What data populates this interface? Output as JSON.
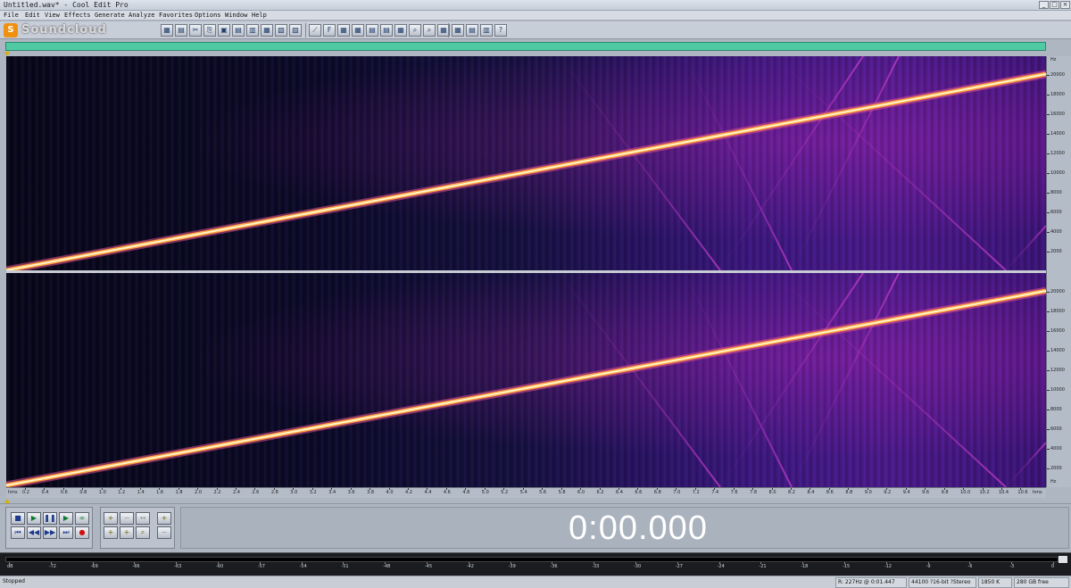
{
  "window": {
    "title": "Untitled.wav* - Cool Edit Pro",
    "minimize": "_",
    "maximize": "□",
    "close": "×"
  },
  "menu": [
    "File",
    "Edit",
    "View",
    "Effects",
    "Generate",
    "Analyze",
    "Favorites",
    "Options",
    "Window",
    "Help"
  ],
  "watermark": {
    "logo": "S",
    "text": "Soundcloud"
  },
  "spectrogram": {
    "channels": 2,
    "colors": {
      "background": "#0a0820",
      "noise": "#4c1a8c",
      "sweep_core": "#fff7c8",
      "sweep_glow": "#e0508c",
      "alias": "#c83cc8"
    }
  },
  "freq_ruler": {
    "unit": "Hz",
    "channel_left": [
      "20000",
      "18000",
      "16000",
      "14000",
      "12000",
      "10000",
      "8000",
      "6000",
      "4000",
      "2000"
    ],
    "channel_right": [
      "20000",
      "18000",
      "16000",
      "14000",
      "12000",
      "10000",
      "8000",
      "6000",
      "4000",
      "2000"
    ]
  },
  "time_ruler": {
    "start_label": "hms",
    "end_label": "hms",
    "labels": [
      "0.2",
      "0.4",
      "0.6",
      "0.8",
      "1.0",
      "1.2",
      "1.4",
      "1.6",
      "1.8",
      "2.0",
      "2.2",
      "2.4",
      "2.6",
      "2.8",
      "3.0",
      "3.2",
      "3.4",
      "3.6",
      "3.8",
      "4.0",
      "4.2",
      "4.4",
      "4.6",
      "4.8",
      "5.0",
      "5.2",
      "5.4",
      "5.6",
      "5.8",
      "6.0",
      "6.2",
      "6.4",
      "6.6",
      "6.8",
      "7.0",
      "7.2",
      "7.4",
      "7.6",
      "7.8",
      "8.0",
      "8.2",
      "8.4",
      "8.6",
      "8.8",
      "9.0",
      "9.2",
      "9.4",
      "9.6",
      "9.8",
      "10.0",
      "10.2",
      "10.4",
      "10.6"
    ]
  },
  "transport": {
    "stop_icon": "■",
    "play_icon": "▶",
    "pause_icon": "❚❚",
    "play_to_end_icon": "▶",
    "loop_icon": "∞",
    "goto_start_icon": "⏮",
    "rewind_icon": "◀◀",
    "forward_icon": "▶▶",
    "goto_end_icon": "⏭",
    "record_icon": "●"
  },
  "zoom": {
    "zoom_in_h": "+",
    "zoom_out_h": "−",
    "zoom_out_full": "↔",
    "zoom_in_left": "+",
    "zoom_in_right": "+",
    "zoom_selection": "⌕",
    "zoom_in_v": "+",
    "zoom_out_v": "−"
  },
  "time_display": "0:00.000",
  "level_meter": {
    "labels": [
      "dB",
      "-72",
      "-69",
      "-66",
      "-63",
      "-60",
      "-57",
      "-54",
      "-51",
      "-48",
      "-45",
      "-42",
      "-39",
      "-36",
      "-33",
      "-30",
      "-27",
      "-24",
      "-21",
      "-18",
      "-15",
      "-12",
      "-9",
      "-6",
      "-3",
      "0"
    ]
  },
  "status": {
    "state": "Stopped",
    "cursor": "R: 227Hz @ 0:01.447",
    "format": "44100 ?16-bit ?Stereo",
    "size": "1850 K",
    "free": "280 GB free"
  }
}
